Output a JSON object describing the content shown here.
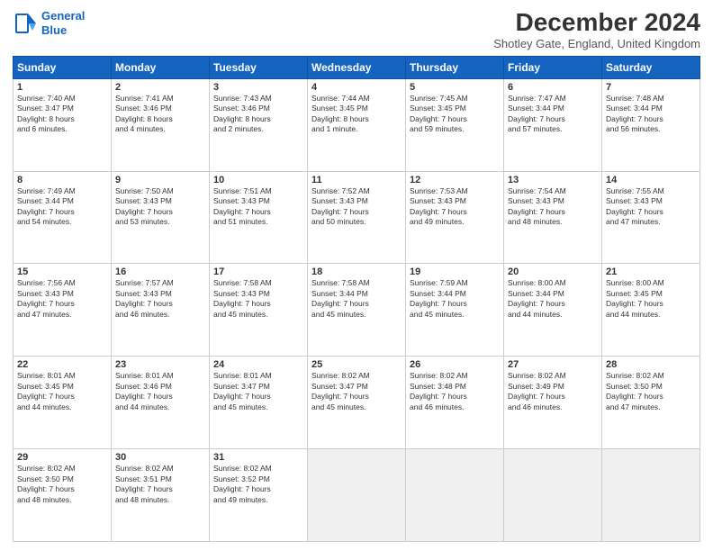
{
  "logo": {
    "line1": "General",
    "line2": "Blue"
  },
  "title": "December 2024",
  "location": "Shotley Gate, England, United Kingdom",
  "days_of_week": [
    "Sunday",
    "Monday",
    "Tuesday",
    "Wednesday",
    "Thursday",
    "Friday",
    "Saturday"
  ],
  "weeks": [
    [
      {
        "day": "1",
        "info": "Sunrise: 7:40 AM\nSunset: 3:47 PM\nDaylight: 8 hours\nand 6 minutes."
      },
      {
        "day": "2",
        "info": "Sunrise: 7:41 AM\nSunset: 3:46 PM\nDaylight: 8 hours\nand 4 minutes."
      },
      {
        "day": "3",
        "info": "Sunrise: 7:43 AM\nSunset: 3:46 PM\nDaylight: 8 hours\nand 2 minutes."
      },
      {
        "day": "4",
        "info": "Sunrise: 7:44 AM\nSunset: 3:45 PM\nDaylight: 8 hours\nand 1 minute."
      },
      {
        "day": "5",
        "info": "Sunrise: 7:45 AM\nSunset: 3:45 PM\nDaylight: 7 hours\nand 59 minutes."
      },
      {
        "day": "6",
        "info": "Sunrise: 7:47 AM\nSunset: 3:44 PM\nDaylight: 7 hours\nand 57 minutes."
      },
      {
        "day": "7",
        "info": "Sunrise: 7:48 AM\nSunset: 3:44 PM\nDaylight: 7 hours\nand 56 minutes."
      }
    ],
    [
      {
        "day": "8",
        "info": "Sunrise: 7:49 AM\nSunset: 3:44 PM\nDaylight: 7 hours\nand 54 minutes."
      },
      {
        "day": "9",
        "info": "Sunrise: 7:50 AM\nSunset: 3:43 PM\nDaylight: 7 hours\nand 53 minutes."
      },
      {
        "day": "10",
        "info": "Sunrise: 7:51 AM\nSunset: 3:43 PM\nDaylight: 7 hours\nand 51 minutes."
      },
      {
        "day": "11",
        "info": "Sunrise: 7:52 AM\nSunset: 3:43 PM\nDaylight: 7 hours\nand 50 minutes."
      },
      {
        "day": "12",
        "info": "Sunrise: 7:53 AM\nSunset: 3:43 PM\nDaylight: 7 hours\nand 49 minutes."
      },
      {
        "day": "13",
        "info": "Sunrise: 7:54 AM\nSunset: 3:43 PM\nDaylight: 7 hours\nand 48 minutes."
      },
      {
        "day": "14",
        "info": "Sunrise: 7:55 AM\nSunset: 3:43 PM\nDaylight: 7 hours\nand 47 minutes."
      }
    ],
    [
      {
        "day": "15",
        "info": "Sunrise: 7:56 AM\nSunset: 3:43 PM\nDaylight: 7 hours\nand 47 minutes."
      },
      {
        "day": "16",
        "info": "Sunrise: 7:57 AM\nSunset: 3:43 PM\nDaylight: 7 hours\nand 46 minutes."
      },
      {
        "day": "17",
        "info": "Sunrise: 7:58 AM\nSunset: 3:43 PM\nDaylight: 7 hours\nand 45 minutes."
      },
      {
        "day": "18",
        "info": "Sunrise: 7:58 AM\nSunset: 3:44 PM\nDaylight: 7 hours\nand 45 minutes."
      },
      {
        "day": "19",
        "info": "Sunrise: 7:59 AM\nSunset: 3:44 PM\nDaylight: 7 hours\nand 45 minutes."
      },
      {
        "day": "20",
        "info": "Sunrise: 8:00 AM\nSunset: 3:44 PM\nDaylight: 7 hours\nand 44 minutes."
      },
      {
        "day": "21",
        "info": "Sunrise: 8:00 AM\nSunset: 3:45 PM\nDaylight: 7 hours\nand 44 minutes."
      }
    ],
    [
      {
        "day": "22",
        "info": "Sunrise: 8:01 AM\nSunset: 3:45 PM\nDaylight: 7 hours\nand 44 minutes."
      },
      {
        "day": "23",
        "info": "Sunrise: 8:01 AM\nSunset: 3:46 PM\nDaylight: 7 hours\nand 44 minutes."
      },
      {
        "day": "24",
        "info": "Sunrise: 8:01 AM\nSunset: 3:47 PM\nDaylight: 7 hours\nand 45 minutes."
      },
      {
        "day": "25",
        "info": "Sunrise: 8:02 AM\nSunset: 3:47 PM\nDaylight: 7 hours\nand 45 minutes."
      },
      {
        "day": "26",
        "info": "Sunrise: 8:02 AM\nSunset: 3:48 PM\nDaylight: 7 hours\nand 46 minutes."
      },
      {
        "day": "27",
        "info": "Sunrise: 8:02 AM\nSunset: 3:49 PM\nDaylight: 7 hours\nand 46 minutes."
      },
      {
        "day": "28",
        "info": "Sunrise: 8:02 AM\nSunset: 3:50 PM\nDaylight: 7 hours\nand 47 minutes."
      }
    ],
    [
      {
        "day": "29",
        "info": "Sunrise: 8:02 AM\nSunset: 3:50 PM\nDaylight: 7 hours\nand 48 minutes."
      },
      {
        "day": "30",
        "info": "Sunrise: 8:02 AM\nSunset: 3:51 PM\nDaylight: 7 hours\nand 48 minutes."
      },
      {
        "day": "31",
        "info": "Sunrise: 8:02 AM\nSunset: 3:52 PM\nDaylight: 7 hours\nand 49 minutes."
      },
      {
        "day": "",
        "info": ""
      },
      {
        "day": "",
        "info": ""
      },
      {
        "day": "",
        "info": ""
      },
      {
        "day": "",
        "info": ""
      }
    ]
  ]
}
